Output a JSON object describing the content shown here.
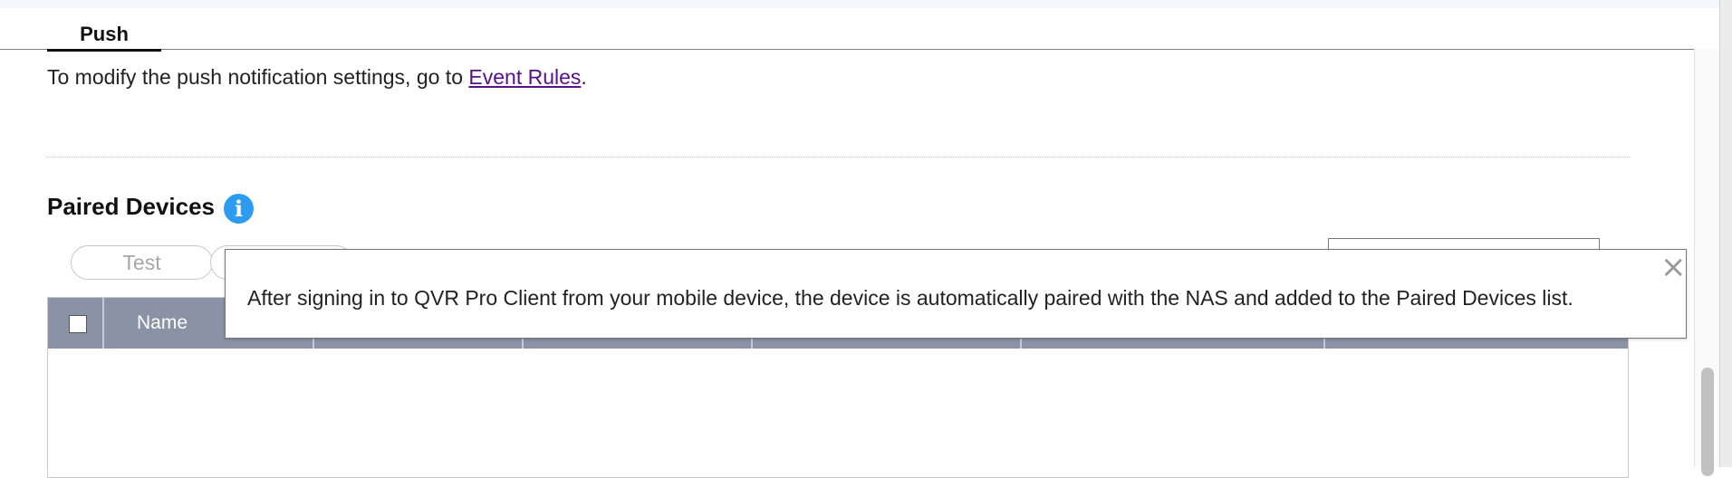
{
  "tabs": {
    "push_label": "Push"
  },
  "notice": {
    "prefix": "To modify the push notification settings, go to ",
    "link_label": "Event Rules",
    "suffix": "."
  },
  "paired_devices": {
    "title": "Paired Devices",
    "info_icon": "i"
  },
  "toolbar": {
    "test_label": "Test"
  },
  "table": {
    "headers": [
      "Name"
    ]
  },
  "tooltip": {
    "text": "After signing in to QVR Pro Client from your mobile device, the device is automatically paired with the NAS and added to the Paired Devices list.",
    "close_glyph": "×"
  },
  "colors": {
    "accent_blue": "#2d9cf0",
    "header_bg": "#8a92a6",
    "link": "#5a0f8c"
  }
}
